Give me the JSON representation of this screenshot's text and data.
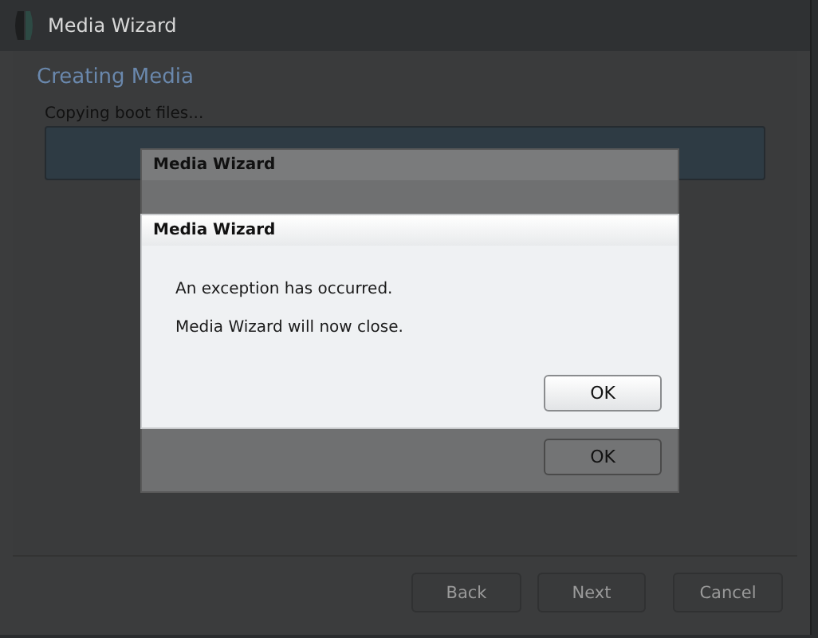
{
  "window": {
    "title": "Media Wizard"
  },
  "page": {
    "heading": "Creating Media",
    "status": "Copying boot files..."
  },
  "buttons": [
    {
      "label": "Back"
    },
    {
      "label": "Next"
    },
    {
      "label": "Cancel"
    }
  ],
  "inactive_dialog": {
    "title": "Media Wizard",
    "button": "OK"
  },
  "error_dialog": {
    "title": "Media Wizard",
    "messages": [
      "An exception has occurred.",
      "Media Wizard will now close."
    ],
    "button": "OK"
  }
}
